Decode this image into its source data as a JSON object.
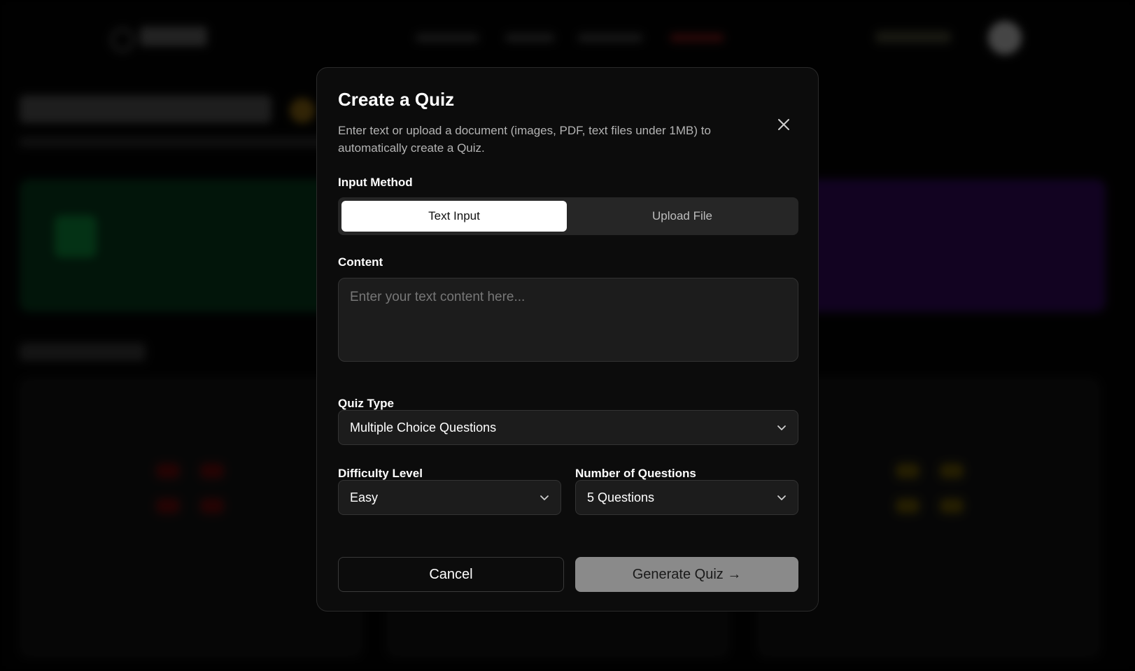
{
  "modal": {
    "title": "Create a Quiz",
    "description": "Enter text or upload a document (images, PDF, text files under 1MB) to automatically create a Quiz.",
    "close_icon": "close-icon"
  },
  "input_method": {
    "label": "Input Method",
    "options": [
      "Text Input",
      "Upload File"
    ],
    "selected": "Text Input"
  },
  "content": {
    "label": "Content",
    "placeholder": "Enter your text content here..."
  },
  "quiz_type": {
    "label": "Quiz Type",
    "value": "Multiple Choice Questions",
    "icon": "chevron-down-icon"
  },
  "difficulty": {
    "label": "Difficulty Level",
    "value": "Easy"
  },
  "num_questions": {
    "label": "Number of Questions",
    "value": "5 Questions"
  },
  "actions": {
    "cancel": "Cancel",
    "generate": "Generate Quiz →"
  },
  "colors": {
    "modal_bg": "#0c0c0c",
    "active_tab_bg": "#ffffff",
    "generate_bg": "#8a8a8a"
  }
}
